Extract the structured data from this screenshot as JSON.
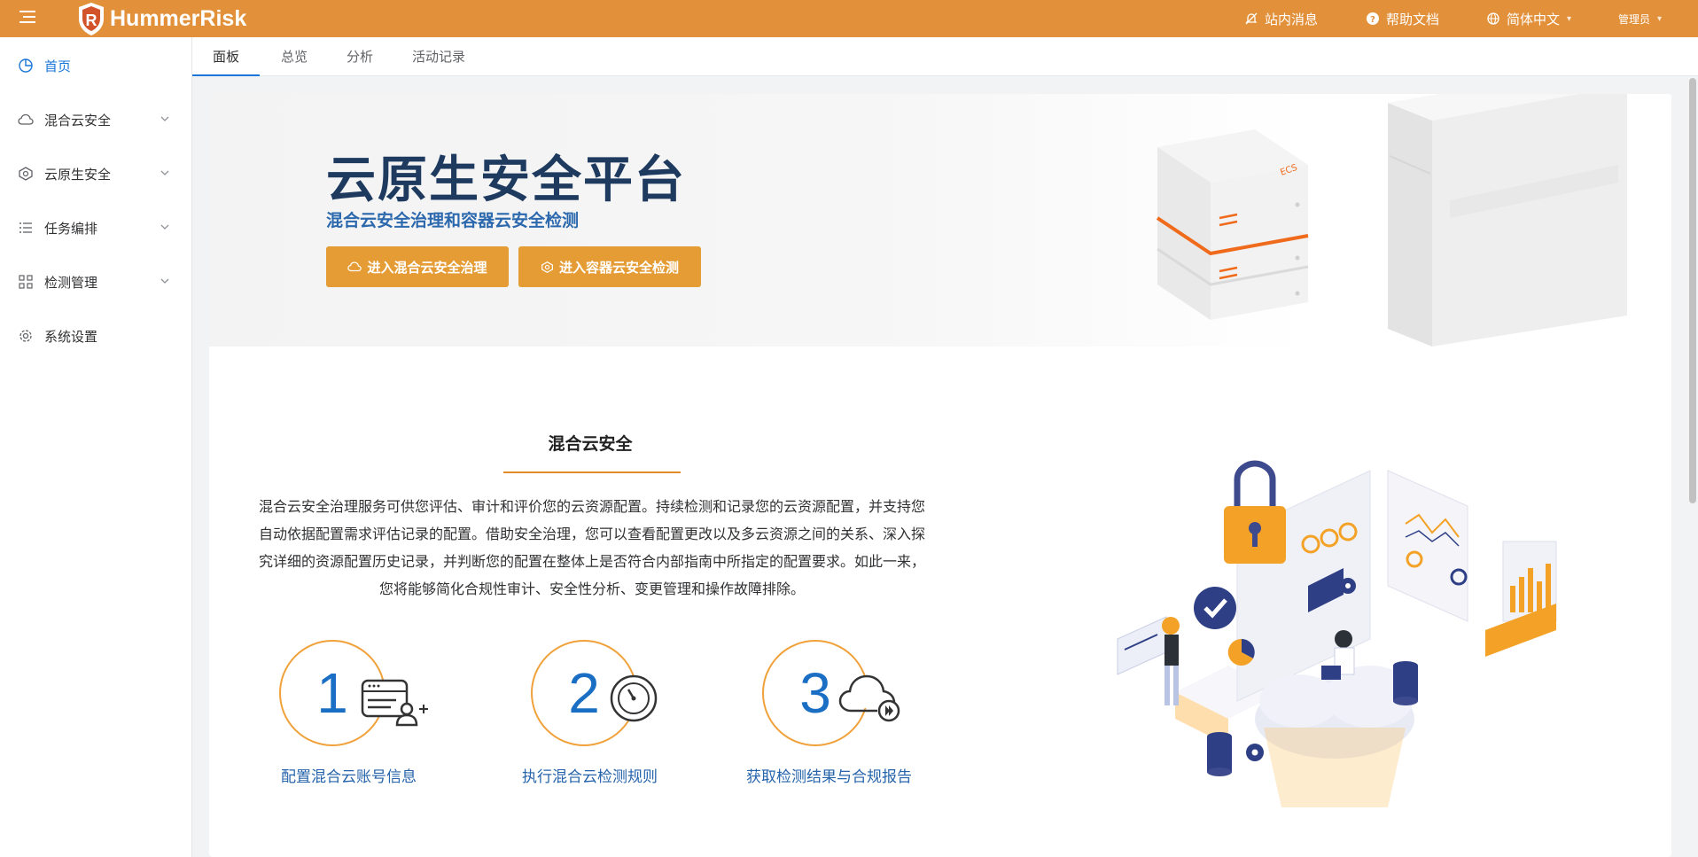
{
  "header": {
    "brand": "HummerRisk",
    "messages_label": "站内消息",
    "help_label": "帮助文档",
    "language_label": "简体中文",
    "user_label": "管理员"
  },
  "sidebar": {
    "items": [
      {
        "label": "首页",
        "icon": "pie-chart-icon",
        "active": true
      },
      {
        "label": "混合云安全",
        "icon": "cloud-icon",
        "expandable": true
      },
      {
        "label": "云原生安全",
        "icon": "network-icon",
        "expandable": true
      },
      {
        "label": "任务编排",
        "icon": "list-icon",
        "expandable": true
      },
      {
        "label": "检测管理",
        "icon": "grid-icon",
        "expandable": true
      },
      {
        "label": "系统设置",
        "icon": "gear-icon"
      }
    ]
  },
  "tabs": [
    {
      "label": "面板",
      "active": true
    },
    {
      "label": "总览"
    },
    {
      "label": "分析"
    },
    {
      "label": "活动记录"
    }
  ],
  "hero": {
    "title": "云原生安全平台",
    "subtitle": "混合云安全治理和容器云安全检测",
    "btn_hybrid": "进入混合云安全治理",
    "btn_container": "进入容器云安全检测",
    "server_label": "ECS"
  },
  "section": {
    "title": "混合云安全",
    "desc_line1": "混合云安全治理服务可供您评估、审计和评价您的云资源配置。持续检测和记录您的云资源配置，并支持您",
    "desc_line2": "自动依据配置需求评估记录的配置。借助安全治理，您可以查看配置更改以及多云资源之间的关系、深入探",
    "desc_line3": "究详细的资源配置历史记录，并判断您的配置在整体上是否符合内部指南中所指定的配置要求。如此一来，",
    "desc_line4": "您将能够简化合规性审计、安全性分析、变更管理和操作故障排除。"
  },
  "steps": [
    {
      "num": "1",
      "label": "配置混合云账号信息",
      "icon": "account-card-icon"
    },
    {
      "num": "2",
      "label": "执行混合云检测规则",
      "icon": "gauge-icon"
    },
    {
      "num": "3",
      "label": "获取检测结果与合规报告",
      "icon": "cloud-play-icon"
    }
  ],
  "colors": {
    "brand_orange": "#e2913a",
    "button_orange": "#e59c35",
    "active_blue": "#1a76d8",
    "title_navy": "#1e3a5f"
  }
}
